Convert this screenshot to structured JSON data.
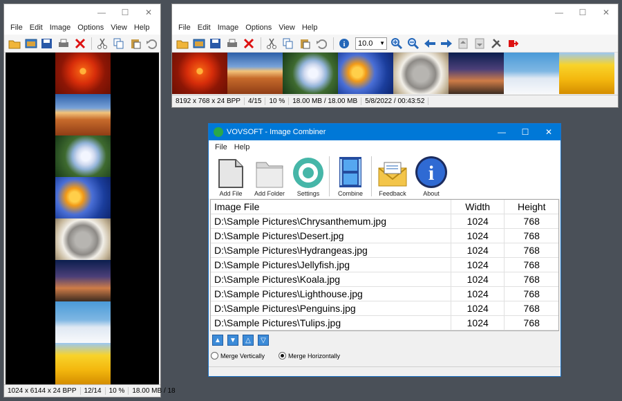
{
  "left_viewer": {
    "menu": [
      "File",
      "Edit",
      "Image",
      "Options",
      "View",
      "Help"
    ],
    "status": [
      "1024 x 6144 x 24 BPP",
      "12/14",
      "10 %",
      "18.00 MB / 18"
    ]
  },
  "top_viewer": {
    "menu": [
      "File",
      "Edit",
      "Image",
      "Options",
      "View",
      "Help"
    ],
    "zoom_value": "10.0",
    "status": [
      "8192 x 768 x 24 BPP",
      "4/15",
      "10 %",
      "18.00 MB / 18.00 MB",
      "5/8/2022 / 00:43:52"
    ]
  },
  "combiner": {
    "title": "VOVSOFT - Image Combiner",
    "menu": [
      "File",
      "Help"
    ],
    "buttons": [
      "Add File",
      "Add Folder",
      "Settings",
      "Combine",
      "Feedback",
      "About"
    ],
    "columns": [
      "Image File",
      "Width",
      "Height"
    ],
    "rows": [
      [
        "D:\\Sample Pictures\\Chrysanthemum.jpg",
        "1024",
        "768"
      ],
      [
        "D:\\Sample Pictures\\Desert.jpg",
        "1024",
        "768"
      ],
      [
        "D:\\Sample Pictures\\Hydrangeas.jpg",
        "1024",
        "768"
      ],
      [
        "D:\\Sample Pictures\\Jellyfish.jpg",
        "1024",
        "768"
      ],
      [
        "D:\\Sample Pictures\\Koala.jpg",
        "1024",
        "768"
      ],
      [
        "D:\\Sample Pictures\\Lighthouse.jpg",
        "1024",
        "768"
      ],
      [
        "D:\\Sample Pictures\\Penguins.jpg",
        "1024",
        "768"
      ],
      [
        "D:\\Sample Pictures\\Tulips.jpg",
        "1024",
        "768"
      ]
    ],
    "merge_vertical": "Merge Vertically",
    "merge_horizontal": "Merge Horizontally",
    "selected_merge": "horizontal"
  },
  "colors": {
    "desktop": "#4a5058",
    "title_active": "#0078d7",
    "icon_blue": "#3c8bd8"
  }
}
